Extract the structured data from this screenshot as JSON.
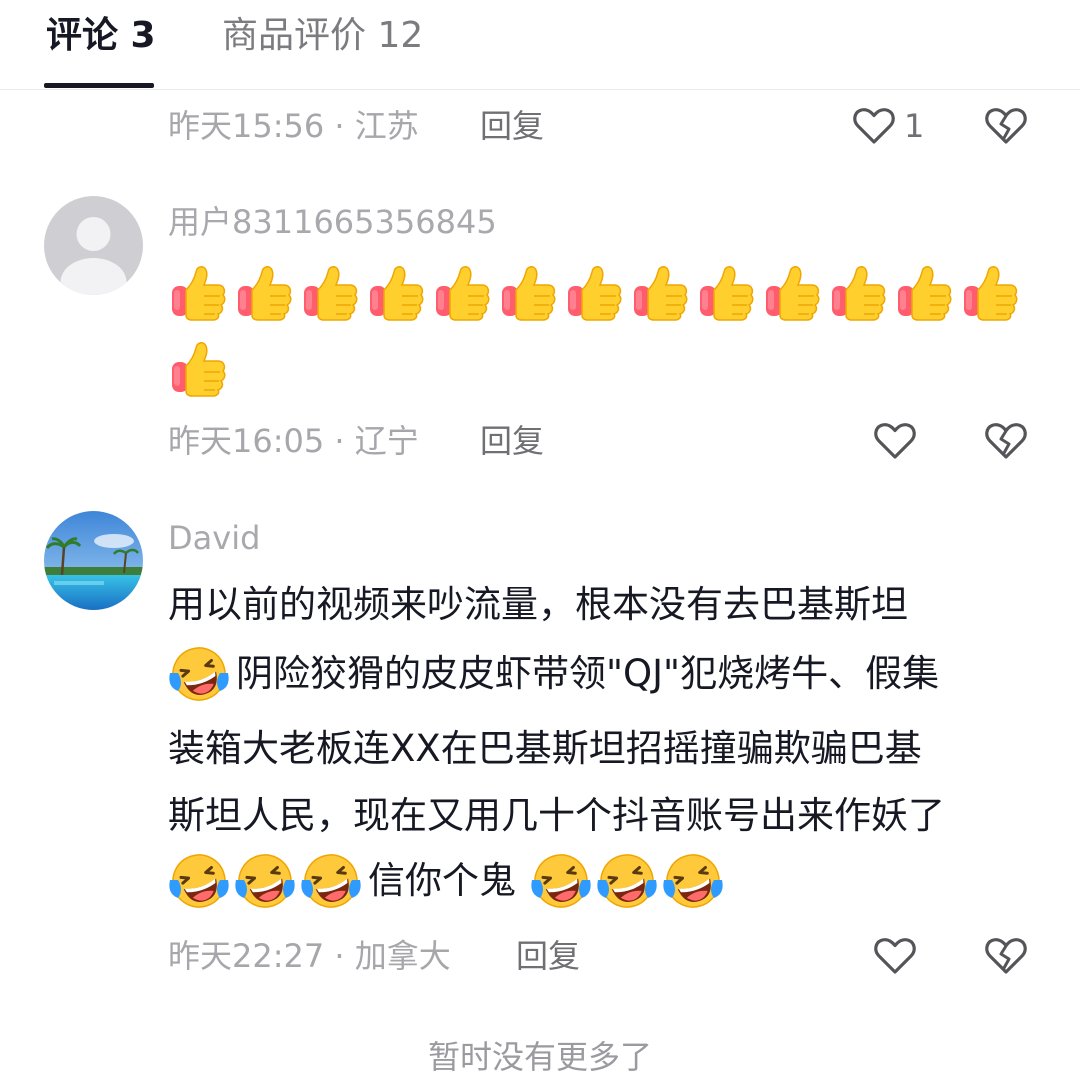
{
  "tabs": [
    {
      "label": "评论 3",
      "active": true
    },
    {
      "label": "商品评价 12",
      "active": false
    }
  ],
  "comments": [
    {
      "meta": "昨天15:56 · 江苏",
      "reply": "回复",
      "like_count": "1"
    },
    {
      "username": "用户8311665356845",
      "emoji": "thumbs-up",
      "emoji_count": 14,
      "meta": "昨天16:05 · 辽宁",
      "reply": "回复"
    },
    {
      "username": "David",
      "lines": [
        "用以前的视频来吵流量，根本没有去巴基斯坦",
        "阴险狡猾的皮皮虾带领\"QJ\"犯烧烤牛、假集",
        "装箱大老板连XX在巴基斯坦招摇撞骗欺骗巴基",
        "斯坦人民，现在又用几十个抖音账号出来作妖了",
        "信你个鬼"
      ],
      "meta": "昨天22:27 · 加拿大",
      "reply": "回复"
    }
  ],
  "footer": "暂时没有更多了",
  "icons": {
    "like": "heart-outline-icon",
    "dislike": "broken-heart-icon",
    "emoji_thumb": "thumbs-up-emoji",
    "emoji_laugh": "laughing-emoji"
  },
  "colors": {
    "text": "#161823",
    "meta": "#a6a6ab",
    "thumb_yellow": "#ffcf2e",
    "thumb_cuff": "#ff5c6e",
    "laugh_face": "#ffc93c",
    "laugh_tears": "#2f9bff"
  }
}
